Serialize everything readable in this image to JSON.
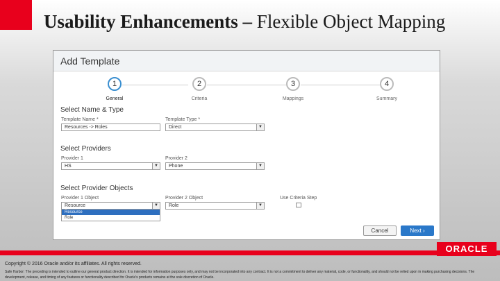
{
  "slide": {
    "title_bold": "Usability Enhancements –",
    "title_rest": " Flexible Object Mapping",
    "colors": {
      "accent_red": "#e8001c",
      "primary_blue": "#2a78c9",
      "step_active": "#3a8fd0"
    }
  },
  "dialog": {
    "title": "Add Template",
    "steps": [
      {
        "number": "1",
        "label": "General",
        "active": true
      },
      {
        "number": "2",
        "label": "Criteria",
        "active": false
      },
      {
        "number": "3",
        "label": "Mappings",
        "active": false
      },
      {
        "number": "4",
        "label": "Summary",
        "active": false
      }
    ],
    "section_name_type": "Select Name & Type",
    "template_name_label": "Template Name *",
    "template_name_value": "Resources -> Roles",
    "template_type_label": "Template Type *",
    "template_type_value": "Direct",
    "section_providers": "Select Providers",
    "provider1_label": "Provider 1",
    "provider1_value": "HS",
    "provider2_label": "Provider 2",
    "provider2_value": "Phone",
    "section_provider_objects": "Select Provider Objects",
    "provider1_object_label": "Provider 1 Object",
    "provider1_object_value": "Resource",
    "provider2_object_label": "Provider 2 Object",
    "provider2_object_value": "Role",
    "use_criteria_step_label": "Use Criteria Step",
    "dropdown_options": [
      "Resource",
      "Role"
    ],
    "cancel_label": "Cancel",
    "next_label": "Next",
    "next_icon": "chevron-right-icon"
  },
  "footer": {
    "logo_text": "ORACLE",
    "copyright": "Copyright © 2016  Oracle and/or its affiliates.  All rights reserved.",
    "safe_harbor": "Safe Harbor: The preceding is intended to outline our general product direction. It is intended for information purposes only, and may not be incorporated into any contract. It is not a commitment to deliver any material, code, or functionality, and should not be relied upon in making purchasing decisions. The development, release, and timing of any features or functionality described for Oracle's products remains at the sole discretion of Oracle."
  }
}
